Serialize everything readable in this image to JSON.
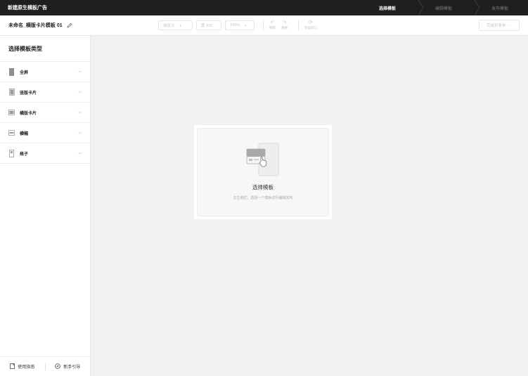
{
  "app": {
    "title": "新建原生横板广告"
  },
  "steps": [
    {
      "label": "选择模板",
      "active": true
    },
    {
      "label": "编辑模板",
      "active": false
    },
    {
      "label": "发布模板",
      "active": false
    }
  ],
  "toolbar": {
    "doc_name": "未命名_横版卡片模板 01",
    "size_preset": "自定义",
    "width_value": "宽 375",
    "zoom": "100%",
    "undo_label": "撤销",
    "redo_label": "重做",
    "reset_label": "恢复默认",
    "finish_label": "完成并发布"
  },
  "sidebar": {
    "title": "选择模板类型",
    "items": [
      {
        "label": "全屏",
        "icon": "fullscreen-template-icon"
      },
      {
        "label": "竖版卡片",
        "icon": "vertical-card-template-icon"
      },
      {
        "label": "横版卡片",
        "icon": "horizontal-card-template-icon"
      },
      {
        "label": "横幅",
        "icon": "banner-template-icon"
      },
      {
        "label": "格子",
        "icon": "grid-template-icon"
      }
    ],
    "footer": {
      "guide_label": "使用指南",
      "tour_label": "新手引导"
    }
  },
  "canvas": {
    "empty_title": "选择模板",
    "empty_hint": "在左侧栏，选择一个模板进行编辑发布"
  },
  "colors": {
    "topbar": "#1f1f1f",
    "canvas_bg": "#f2f2f2",
    "border": "#e6e6e6"
  }
}
